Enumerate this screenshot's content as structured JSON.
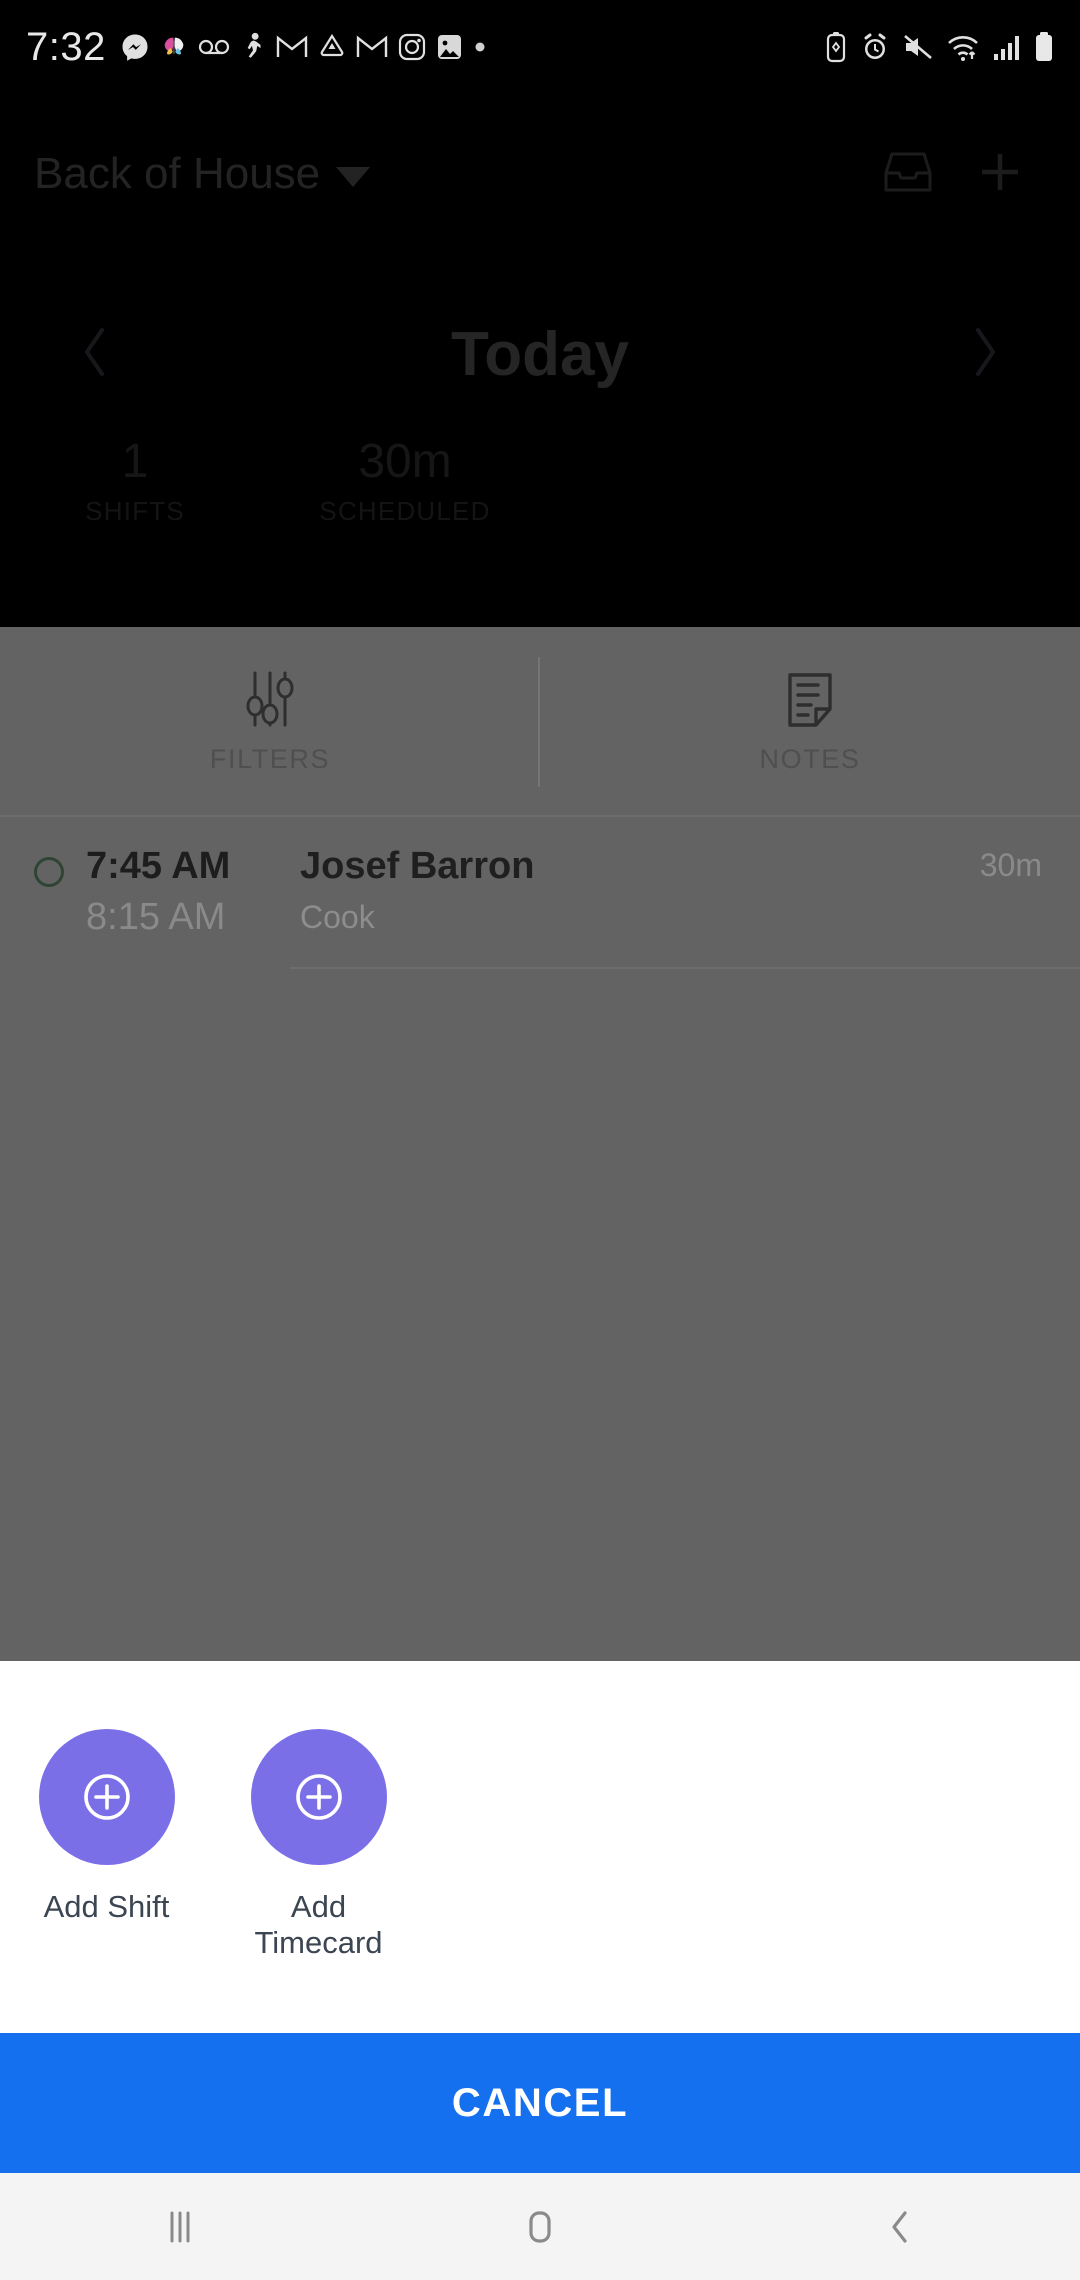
{
  "status_bar": {
    "time": "7:32",
    "left_icons": [
      {
        "name": "messenger-icon",
        "label": "Messenger"
      },
      {
        "name": "butterfly-app-icon",
        "label": "Butterfly app"
      },
      {
        "name": "voicemail-icon",
        "label": "Voicemail"
      },
      {
        "name": "running-person-icon",
        "label": "Fitness"
      },
      {
        "name": "gmail-icon",
        "label": "Gmail"
      },
      {
        "name": "drive-icon",
        "label": "Google Drive"
      },
      {
        "name": "gmail-icon-2",
        "label": "Gmail"
      },
      {
        "name": "instagram-icon",
        "label": "Instagram"
      },
      {
        "name": "photos-icon",
        "label": "Photos"
      },
      {
        "name": "more-dot-icon",
        "label": "More notifications"
      }
    ],
    "right_icons": [
      {
        "name": "battery-saver-icon",
        "label": "Battery saver"
      },
      {
        "name": "alarm-icon",
        "label": "Alarm set"
      },
      {
        "name": "mute-icon",
        "label": "Sound muted"
      },
      {
        "name": "wifi-icon",
        "label": "Wi-Fi connected"
      },
      {
        "name": "cellular-signal-icon",
        "label": "Cellular signal"
      },
      {
        "name": "battery-icon",
        "label": "Battery"
      }
    ]
  },
  "header": {
    "location": "Back of House",
    "caret": "dropdown-caret",
    "inbox_icon": "inbox-icon",
    "add_icon": "plus-icon"
  },
  "date_nav": {
    "prev_label": "previous-day",
    "title": "Today",
    "next_label": "next-day"
  },
  "stats": [
    {
      "value": "1",
      "label": "SHIFTS"
    },
    {
      "value": "30m",
      "label": "SCHEDULED"
    }
  ],
  "tabs": [
    {
      "label": "FILTERS",
      "icon": "sliders-icon"
    },
    {
      "label": "NOTES",
      "icon": "note-icon"
    }
  ],
  "shifts": [
    {
      "status": "unconfirmed",
      "start_time": "7:45 AM",
      "end_time": "8:15 AM",
      "person": "Josef Barron",
      "role": "Cook",
      "duration": "30m"
    }
  ],
  "bottom_sheet": {
    "actions": [
      {
        "label": "Add Shift",
        "icon": "plus-circle-icon"
      },
      {
        "label": "Add Timecard",
        "icon": "plus-circle-icon"
      }
    ],
    "cancel_label": "CANCEL"
  },
  "nav_bar": {
    "recents_label": "recents-button",
    "home_label": "home-button",
    "back_label": "back-button"
  },
  "colors": {
    "accent_purple": "#7b6fe8",
    "cancel_blue": "#1470ef",
    "scrim_gray": "#636363",
    "sheet_white": "#ffffff",
    "nav_bar_gray": "#f4f4f4"
  }
}
